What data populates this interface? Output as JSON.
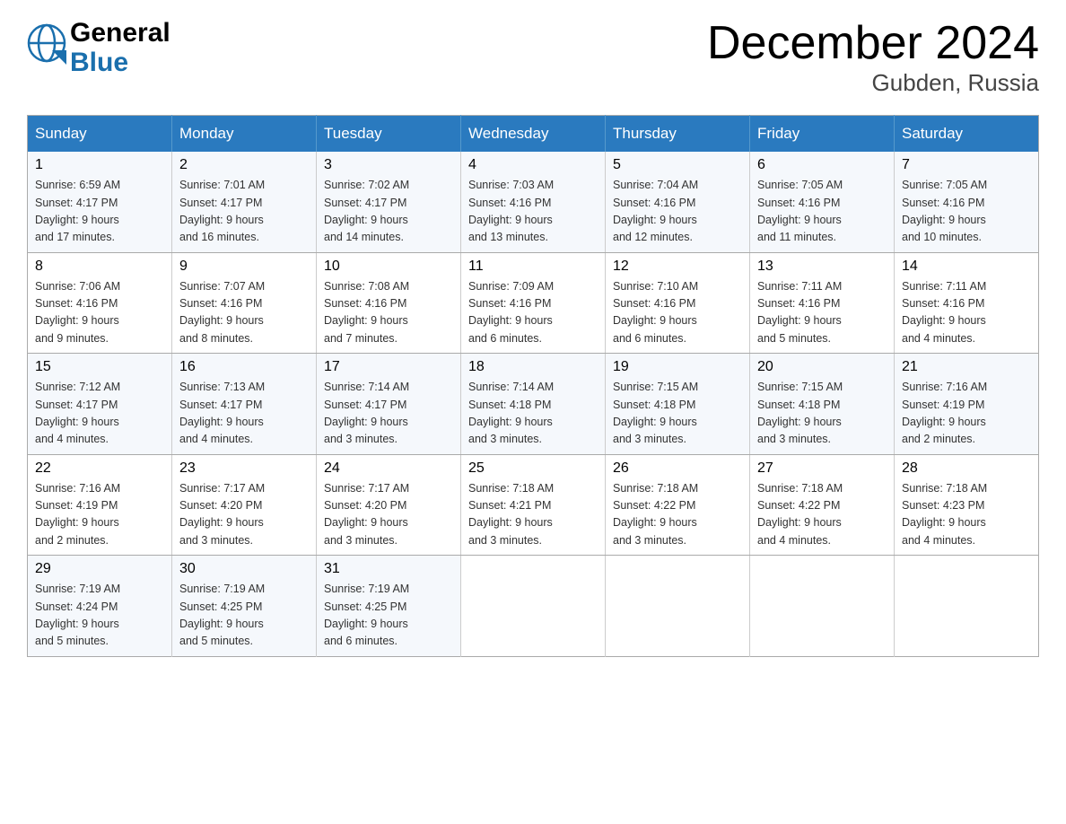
{
  "header": {
    "logo": {
      "general": "General",
      "blue": "Blue"
    },
    "title": "December 2024",
    "location": "Gubden, Russia"
  },
  "calendar": {
    "days_of_week": [
      "Sunday",
      "Monday",
      "Tuesday",
      "Wednesday",
      "Thursday",
      "Friday",
      "Saturday"
    ],
    "weeks": [
      [
        {
          "day": "1",
          "sunrise": "6:59 AM",
          "sunset": "4:17 PM",
          "daylight": "9 hours and 17 minutes."
        },
        {
          "day": "2",
          "sunrise": "7:01 AM",
          "sunset": "4:17 PM",
          "daylight": "9 hours and 16 minutes."
        },
        {
          "day": "3",
          "sunrise": "7:02 AM",
          "sunset": "4:17 PM",
          "daylight": "9 hours and 14 minutes."
        },
        {
          "day": "4",
          "sunrise": "7:03 AM",
          "sunset": "4:16 PM",
          "daylight": "9 hours and 13 minutes."
        },
        {
          "day": "5",
          "sunrise": "7:04 AM",
          "sunset": "4:16 PM",
          "daylight": "9 hours and 12 minutes."
        },
        {
          "day": "6",
          "sunrise": "7:05 AM",
          "sunset": "4:16 PM",
          "daylight": "9 hours and 11 minutes."
        },
        {
          "day": "7",
          "sunrise": "7:05 AM",
          "sunset": "4:16 PM",
          "daylight": "9 hours and 10 minutes."
        }
      ],
      [
        {
          "day": "8",
          "sunrise": "7:06 AM",
          "sunset": "4:16 PM",
          "daylight": "9 hours and 9 minutes."
        },
        {
          "day": "9",
          "sunrise": "7:07 AM",
          "sunset": "4:16 PM",
          "daylight": "9 hours and 8 minutes."
        },
        {
          "day": "10",
          "sunrise": "7:08 AM",
          "sunset": "4:16 PM",
          "daylight": "9 hours and 7 minutes."
        },
        {
          "day": "11",
          "sunrise": "7:09 AM",
          "sunset": "4:16 PM",
          "daylight": "9 hours and 6 minutes."
        },
        {
          "day": "12",
          "sunrise": "7:10 AM",
          "sunset": "4:16 PM",
          "daylight": "9 hours and 6 minutes."
        },
        {
          "day": "13",
          "sunrise": "7:11 AM",
          "sunset": "4:16 PM",
          "daylight": "9 hours and 5 minutes."
        },
        {
          "day": "14",
          "sunrise": "7:11 AM",
          "sunset": "4:16 PM",
          "daylight": "9 hours and 4 minutes."
        }
      ],
      [
        {
          "day": "15",
          "sunrise": "7:12 AM",
          "sunset": "4:17 PM",
          "daylight": "9 hours and 4 minutes."
        },
        {
          "day": "16",
          "sunrise": "7:13 AM",
          "sunset": "4:17 PM",
          "daylight": "9 hours and 4 minutes."
        },
        {
          "day": "17",
          "sunrise": "7:14 AM",
          "sunset": "4:17 PM",
          "daylight": "9 hours and 3 minutes."
        },
        {
          "day": "18",
          "sunrise": "7:14 AM",
          "sunset": "4:18 PM",
          "daylight": "9 hours and 3 minutes."
        },
        {
          "day": "19",
          "sunrise": "7:15 AM",
          "sunset": "4:18 PM",
          "daylight": "9 hours and 3 minutes."
        },
        {
          "day": "20",
          "sunrise": "7:15 AM",
          "sunset": "4:18 PM",
          "daylight": "9 hours and 3 minutes."
        },
        {
          "day": "21",
          "sunrise": "7:16 AM",
          "sunset": "4:19 PM",
          "daylight": "9 hours and 2 minutes."
        }
      ],
      [
        {
          "day": "22",
          "sunrise": "7:16 AM",
          "sunset": "4:19 PM",
          "daylight": "9 hours and 2 minutes."
        },
        {
          "day": "23",
          "sunrise": "7:17 AM",
          "sunset": "4:20 PM",
          "daylight": "9 hours and 3 minutes."
        },
        {
          "day": "24",
          "sunrise": "7:17 AM",
          "sunset": "4:20 PM",
          "daylight": "9 hours and 3 minutes."
        },
        {
          "day": "25",
          "sunrise": "7:18 AM",
          "sunset": "4:21 PM",
          "daylight": "9 hours and 3 minutes."
        },
        {
          "day": "26",
          "sunrise": "7:18 AM",
          "sunset": "4:22 PM",
          "daylight": "9 hours and 3 minutes."
        },
        {
          "day": "27",
          "sunrise": "7:18 AM",
          "sunset": "4:22 PM",
          "daylight": "9 hours and 4 minutes."
        },
        {
          "day": "28",
          "sunrise": "7:18 AM",
          "sunset": "4:23 PM",
          "daylight": "9 hours and 4 minutes."
        }
      ],
      [
        {
          "day": "29",
          "sunrise": "7:19 AM",
          "sunset": "4:24 PM",
          "daylight": "9 hours and 5 minutes."
        },
        {
          "day": "30",
          "sunrise": "7:19 AM",
          "sunset": "4:25 PM",
          "daylight": "9 hours and 5 minutes."
        },
        {
          "day": "31",
          "sunrise": "7:19 AM",
          "sunset": "4:25 PM",
          "daylight": "9 hours and 6 minutes."
        },
        null,
        null,
        null,
        null
      ]
    ],
    "labels": {
      "sunrise": "Sunrise:",
      "sunset": "Sunset:",
      "daylight": "Daylight:"
    }
  }
}
